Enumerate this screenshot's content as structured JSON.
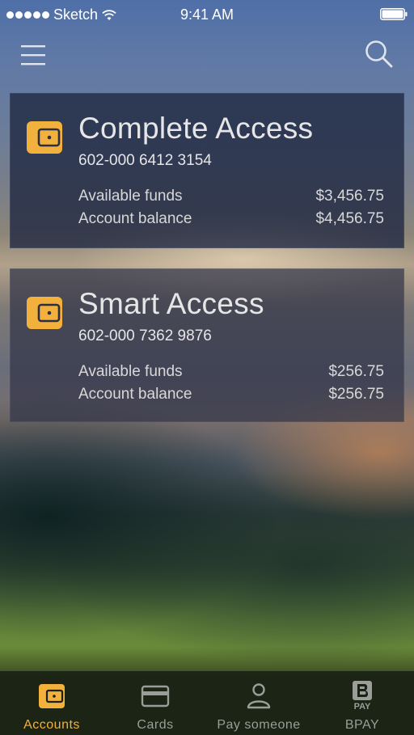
{
  "status_bar": {
    "carrier": "Sketch",
    "time": "9:41 AM"
  },
  "nav": {
    "menu_icon": "hamburger-menu-icon",
    "search_icon": "search-icon"
  },
  "accounts": [
    {
      "name": "Complete Access",
      "number": "602-000 6412 3154",
      "available_label": "Available funds",
      "available_value": "$3,456.75",
      "balance_label": "Account balance",
      "balance_value": "$4,456.75"
    },
    {
      "name": "Smart Access",
      "number": "602-000 7362 9876",
      "available_label": "Available funds",
      "available_value": "$256.75",
      "balance_label": "Account balance",
      "balance_value": "$256.75"
    }
  ],
  "tabs": [
    {
      "label": "Accounts",
      "icon": "wallet-icon",
      "active": true
    },
    {
      "label": "Cards",
      "icon": "credit-card-icon",
      "active": false
    },
    {
      "label": "Pay someone",
      "icon": "person-icon",
      "active": false
    },
    {
      "label": "BPAY",
      "icon": "bpay-logo-icon",
      "active": false,
      "icon_text": "PAY"
    }
  ],
  "colors": {
    "accent": "#f2b13c",
    "card": "#1e2640",
    "tab_inactive": "#9a9d98"
  }
}
